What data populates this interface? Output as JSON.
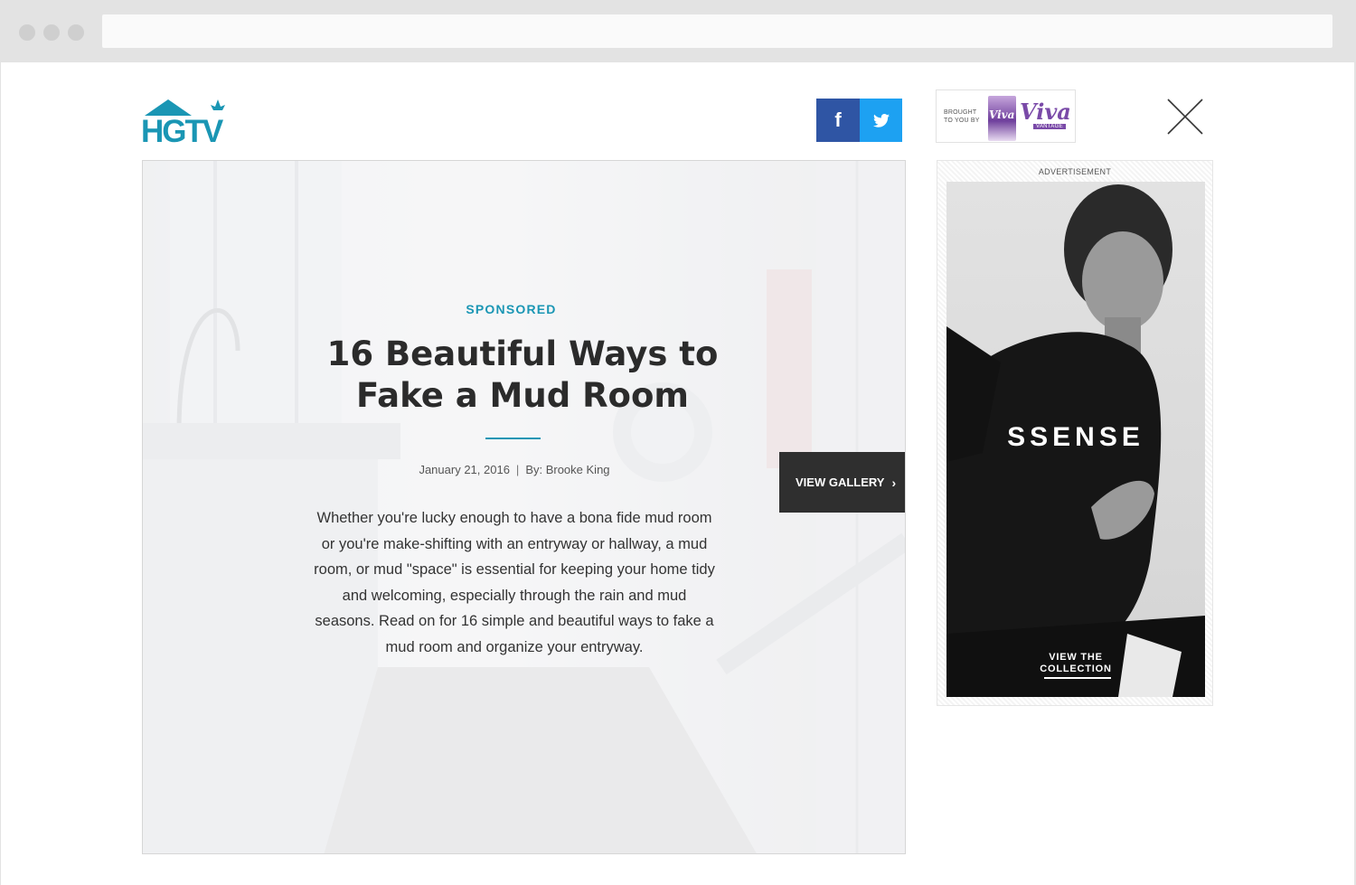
{
  "brand": {
    "logo_text": "HGTV"
  },
  "social": {
    "facebook_icon": "f",
    "twitter_icon": "twitter-bird"
  },
  "sponsor": {
    "label_line1": "BROUGHT",
    "label_line2": "TO YOU BY",
    "pack_text": "Viva",
    "brand_text": "Viva",
    "brand_sub": "VANTAGE"
  },
  "article": {
    "tag": "SPONSORED",
    "title": "16 Beautiful Ways to Fake a Mud Room",
    "date": "January 21, 2016",
    "separator": "|",
    "author": "By: Brooke King",
    "description": "Whether you're lucky enough to have a bona fide mud room or you're make-shifting with an entryway or hallway, a mud room, or mud \"space\" is essential for keeping your home tidy and welcoming, especially through the rain and mud seasons. Read on for 16 simple and beautiful ways to fake a mud room and organize your entryway."
  },
  "gallery_button": {
    "label": "VIEW GALLERY",
    "chevron": "›"
  },
  "ad": {
    "label": "ADVERTISEMENT",
    "brand": "SSENSE",
    "cta_line1": "VIEW THE",
    "cta_line2": "COLLECTION"
  },
  "colors": {
    "accent": "#1a96b4",
    "facebook": "#2f55a4",
    "twitter": "#1da1f2",
    "button_dark": "#2f2f2f"
  }
}
